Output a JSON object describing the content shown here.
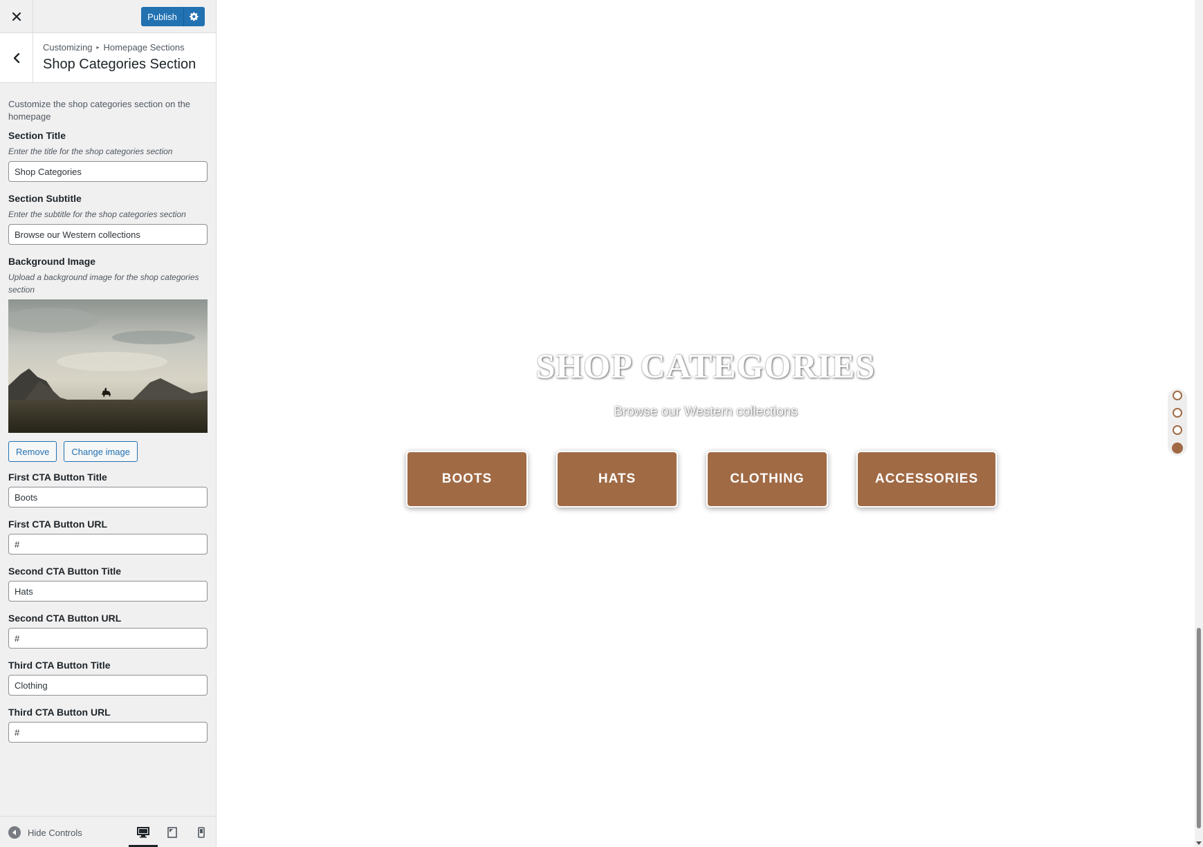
{
  "topbar": {
    "close_icon": "close-icon",
    "publish_label": "Publish",
    "settings_icon": "gear-icon"
  },
  "section_header": {
    "breadcrumb_root": "Customizing",
    "breadcrumb_parent": "Homepage Sections",
    "title": "Shop Categories Section"
  },
  "panel": {
    "description": "Customize the shop categories section on the homepage",
    "section_title": {
      "label": "Section Title",
      "help": "Enter the title for the shop categories section",
      "value": "Shop Categories"
    },
    "section_subtitle": {
      "label": "Section Subtitle",
      "help": "Enter the subtitle for the shop categories section",
      "value": "Browse our Western collections"
    },
    "background_image": {
      "label": "Background Image",
      "help": "Upload a background image for the shop categories section",
      "remove_label": "Remove",
      "change_label": "Change image"
    },
    "first_cta_title": {
      "label": "First CTA Button Title",
      "value": "Boots"
    },
    "first_cta_url": {
      "label": "First CTA Button URL",
      "value": "#"
    },
    "second_cta_title": {
      "label": "Second CTA Button Title",
      "value": "Hats"
    },
    "second_cta_url": {
      "label": "Second CTA Button URL",
      "value": "#"
    },
    "third_cta_title": {
      "label": "Third CTA Button Title",
      "value": "Clothing"
    },
    "third_cta_url": {
      "label": "Third CTA Button URL",
      "value": "#"
    }
  },
  "footer": {
    "hide_controls_label": "Hide Controls",
    "devices": [
      "desktop",
      "tablet",
      "mobile"
    ],
    "active_device": "desktop"
  },
  "preview": {
    "title": "SHOP CATEGORIES",
    "subtitle": "Browse our Western collections",
    "buttons": [
      "BOOTS",
      "HATS",
      "CLOTHING",
      "ACCESSORIES"
    ],
    "nav_dots_count": 4,
    "active_dot": 4
  },
  "colors": {
    "accent": "#2271b1",
    "brand_brown": "#a06a45",
    "sidebar_bg": "#f0f0f1"
  }
}
